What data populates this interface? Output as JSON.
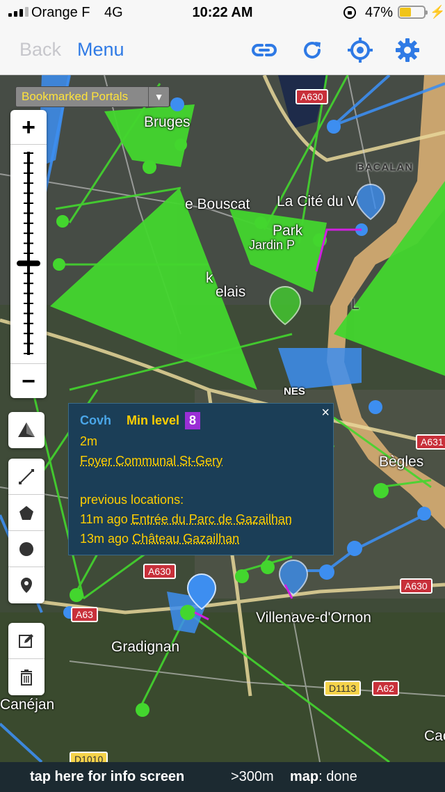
{
  "status_bar": {
    "carrier": "Orange F",
    "network": "4G",
    "time": "10:22 AM",
    "battery_percent": "47%",
    "battery_level": 0.47
  },
  "nav_bar": {
    "back_label": "Back",
    "menu_label": "Menu",
    "icons": [
      "link-icon",
      "refresh-icon",
      "locate-icon",
      "gear-icon"
    ]
  },
  "map": {
    "portal_filter": "Bookmarked Portals",
    "places": {
      "bruges": "Bruges",
      "le_bouscat": "e Bouscat",
      "la_cite": "La Cité du V",
      "bacalan": "BACALAN",
      "park": "Park",
      "jardin": "Jardin P",
      "k": "k",
      "elais": "elais",
      "nes": "NES",
      "begles": "Bègles",
      "villenave": "Villenave-d'Ornon",
      "gradignan": "Gradignan",
      "canejan": "Canéjan",
      "cac": "Cac",
      "a_letter": "L"
    },
    "roads": {
      "a630_top": "A630",
      "a631": "A631",
      "a630_left": "A630",
      "a630_right": "A630",
      "a63": "A63",
      "d1113": "D1113",
      "a62": "A62",
      "d1010": "D1010"
    },
    "colors": {
      "enlightened": "#43d62e",
      "resistance": "#3d8ef0",
      "accent": "#2f7ae5"
    }
  },
  "zoom": {
    "plus": "+",
    "minus": "−",
    "level": 0.55
  },
  "tools": [
    "polyline-icon",
    "polygon-icon",
    "circle-icon",
    "marker-icon",
    "edit-icon",
    "trash-icon"
  ],
  "popup": {
    "agent": "Covh",
    "min_level_label": "Min level",
    "min_level": "8",
    "time_ago": "2m",
    "location": "Foyer Communal St-Gery",
    "previous_label": "previous locations:",
    "previous": [
      {
        "ago": "11m ago",
        "place": "Entrée du Parc de Gazailhan"
      },
      {
        "ago": "13m ago",
        "place": "Château Gazailhan"
      }
    ],
    "close": "×"
  },
  "bottom_bar": {
    "info": "tap here for info screen",
    "distance": ">300m",
    "map_label": "map",
    "map_status": ": done"
  }
}
